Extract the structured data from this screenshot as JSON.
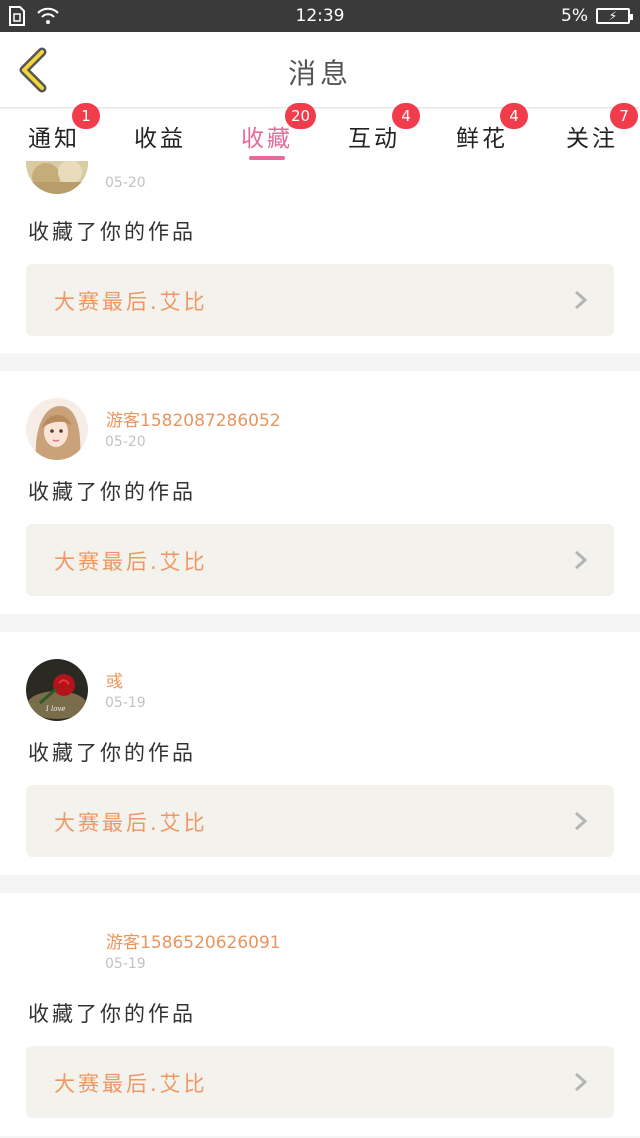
{
  "status_bar": {
    "time": "12:39",
    "battery": "5%"
  },
  "header": {
    "title": "消息"
  },
  "tabs": [
    {
      "label": "通知",
      "badge": "1"
    },
    {
      "label": "收益",
      "badge": ""
    },
    {
      "label": "收藏",
      "badge": "20"
    },
    {
      "label": "互动",
      "badge": "4"
    },
    {
      "label": "鲜花",
      "badge": "4"
    },
    {
      "label": "关注",
      "badge": "7"
    }
  ],
  "messages": [
    {
      "username": "",
      "date": "05-20",
      "action": "收藏了你的作品",
      "work_title": "大赛最后.艾比",
      "avatar": "avatar-partial"
    },
    {
      "username": "游客1582087286052",
      "date": "05-20",
      "action": "收藏了你的作品",
      "work_title": "大赛最后.艾比",
      "avatar": "avatar-girl"
    },
    {
      "username": "彧",
      "date": "05-19",
      "action": "收藏了你的作品",
      "work_title": "大赛最后.艾比",
      "avatar": "avatar-rose"
    },
    {
      "username": "游客1586520626091",
      "date": "05-19",
      "action": "收藏了你的作品",
      "work_title": "大赛最后.艾比",
      "avatar": "avatar-blank"
    }
  ],
  "colors": {
    "accent": "#e66a9a",
    "badge": "#f13d4b",
    "username": "#e9955e",
    "work_title": "#ef9865"
  }
}
